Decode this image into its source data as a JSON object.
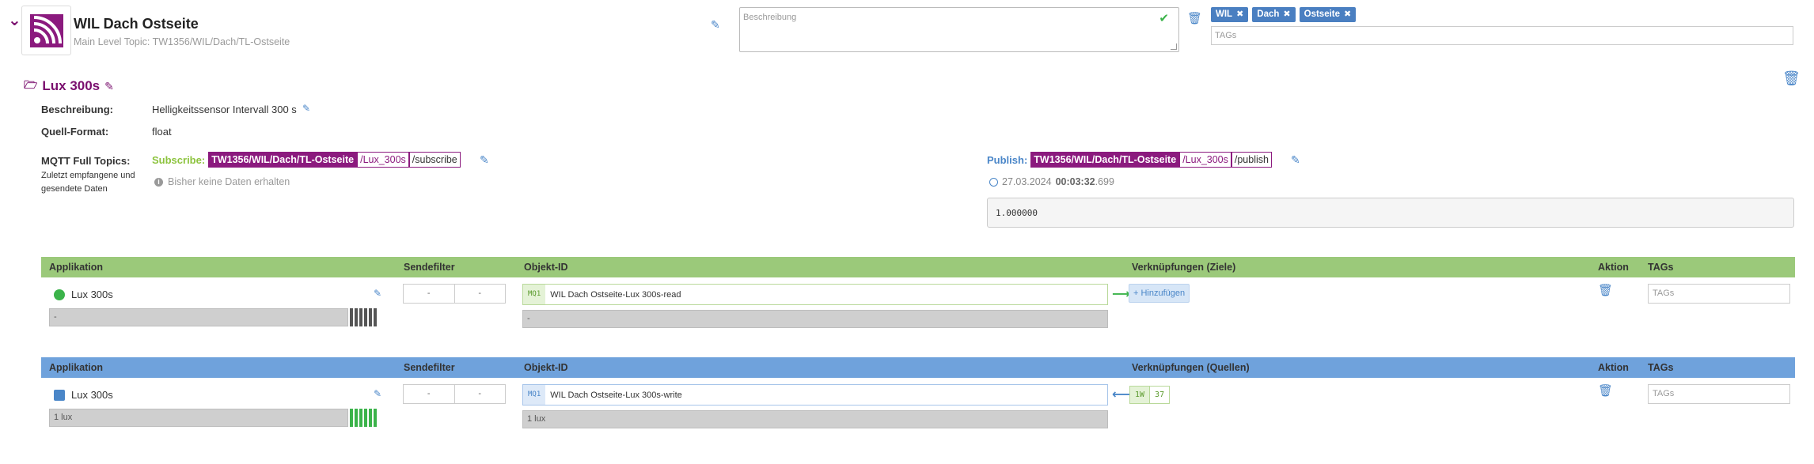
{
  "header": {
    "title": "WIL Dach Ostseite",
    "subtitle": "Main Level Topic: TW1356/WIL/Dach/TL-Ostseite",
    "description_placeholder": "Beschreibung",
    "tags": [
      "WIL",
      "Dach",
      "Ostseite"
    ],
    "tags_placeholder": "TAGs"
  },
  "section": {
    "title": "Lux 300s",
    "beschreibung_label": "Beschreibung:",
    "beschreibung_value": "Helligkeitssensor Intervall 300 s",
    "quellformat_label": "Quell-Format:",
    "quellformat_value": "float",
    "mqtt_label": "MQTT Full Topics:",
    "mqtt_sub_label": "Zuletzt empfangene und gesendete Daten",
    "subscribe": {
      "label": "Subscribe:",
      "main": "TW1356/WIL/Dach/TL-Ostseite",
      "mid": "/Lux_300s",
      "end": "/subscribe"
    },
    "publish": {
      "label": "Publish:",
      "main": "TW1356/WIL/Dach/TL-Ostseite",
      "mid": "/Lux_300s",
      "end": "/publish"
    },
    "no_data": "Bisher keine Daten erhalten",
    "timestamp_date": "27.03.2024",
    "timestamp_time": "00:03:32",
    "timestamp_ms": ".699",
    "last_value": "1.000000"
  },
  "table_read": {
    "headers": {
      "app": "Applikation",
      "sendefilter": "Sendefilter",
      "objekt": "Objekt-ID",
      "verkn": "Verknüpfungen (Ziele)",
      "aktion": "Aktion",
      "tags": "TAGs"
    },
    "row": {
      "app_name": "Lux 300s",
      "app_value": "-",
      "filter_a": "-",
      "filter_b": "-",
      "badge": "MQ1",
      "object_id": "WIL Dach Ostseite-Lux 300s-read",
      "object_value": "-",
      "add_label": "+ Hinzufügen",
      "tags_placeholder": "TAGs"
    }
  },
  "table_write": {
    "headers": {
      "app": "Applikation",
      "sendefilter": "Sendefilter",
      "objekt": "Objekt-ID",
      "verkn": "Verknüpfungen (Quellen)",
      "aktion": "Aktion",
      "tags": "TAGs"
    },
    "row": {
      "app_name": "Lux 300s",
      "app_value": "1 lux",
      "filter_a": "-",
      "filter_b": "-",
      "badge": "MQ1",
      "object_id": "WIL Dach Ostseite-Lux 300s-write",
      "object_value": "1 lux",
      "source_a": "1W",
      "source_b": "37",
      "tags_placeholder": "TAGs"
    }
  },
  "colors": {
    "brand_purple": "#8b1a7e",
    "header_green": "#9bc97a",
    "header_blue": "#6fa2dc",
    "accent_blue": "#4a86c8",
    "ok_green": "#3bb34a"
  },
  "icons": [
    "collapse-chevron-icon",
    "rss-feed-icon",
    "pencil-icon",
    "check-icon",
    "trash-icon",
    "folder-open-icon",
    "info-icon",
    "clock-icon",
    "arrow-right-icon",
    "arrow-left-icon"
  ]
}
